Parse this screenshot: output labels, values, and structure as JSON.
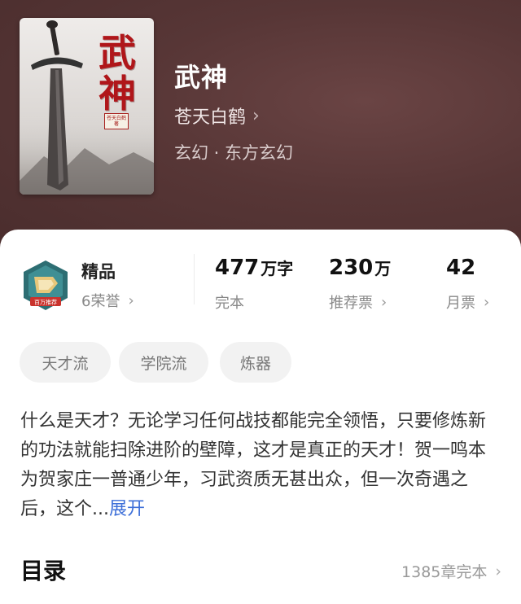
{
  "book": {
    "cover_title": "武神",
    "cover_tag": "苍天白鹤著",
    "title": "武神",
    "author": "苍天白鹤",
    "genre": "玄幻 · 东方玄幻"
  },
  "badge": {
    "icon": "shield-badge-icon",
    "ribbon_text": "百万推荐",
    "grade": "精品",
    "honors": "6荣誉"
  },
  "stats": {
    "words": {
      "value": "477",
      "unit": "万字",
      "label": "完本"
    },
    "votes": {
      "value": "230",
      "unit": "万",
      "label": "推荐票"
    },
    "monthly": {
      "value": "42",
      "unit": "",
      "label": "月票"
    }
  },
  "tags": [
    "天才流",
    "学院流",
    "炼器"
  ],
  "synopsis": {
    "text": "什么是天才？无论学习任何战技都能完全领悟，只要修炼新的功法就能扫除进阶的壁障，这才是真正的天才！贺一鸣本为贺家庄一普通少年，习武资质无甚出众，但一次奇遇之后，这个...",
    "expand_label": "展开"
  },
  "toc": {
    "title": "目录",
    "meta": "1385章完本"
  },
  "icons": {
    "chevron": "›"
  },
  "colors": {
    "hero_bg": "#573636",
    "link": "#3d6fd8",
    "cover_red": "#b0161a"
  }
}
